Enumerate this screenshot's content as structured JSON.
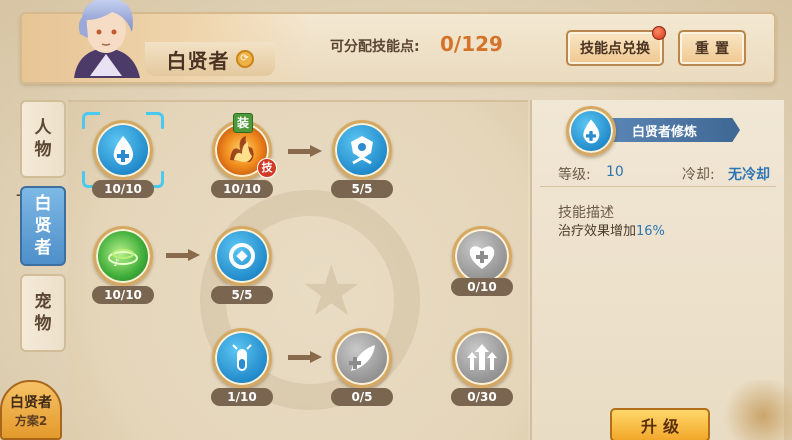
{
  "header": {
    "class_name": "白贤者",
    "points_label": "可分配技能点:",
    "points_value": "0/129",
    "exchange_label": "技能点兑换",
    "reset_label": "重置"
  },
  "tabs": [
    {
      "label_1": "人",
      "label_2": "物"
    },
    {
      "label_1": "白",
      "label_2": "贤",
      "label_3": "者"
    },
    {
      "label_1": "宠",
      "label_2": "物"
    }
  ],
  "plan": {
    "name": "白贤者",
    "sub": "方案2"
  },
  "tree": {
    "nodes": [
      {
        "count": "10/10",
        "icon": "water-drop-plus-icon"
      },
      {
        "count": "10/10",
        "icon": "fire-skill-icon",
        "equip_badge": "装",
        "skill_badge": "技"
      },
      {
        "count": "5/5",
        "icon": "guardian-shield-icon"
      },
      {
        "count": "10/10",
        "icon": "green-vortex-icon"
      },
      {
        "count": "5/5",
        "icon": "cycle-arrows-icon"
      },
      {
        "count": "0/10",
        "icon": "heart-plus-icon"
      },
      {
        "count": "1/10",
        "icon": "potion-vial-icon"
      },
      {
        "count": "0/5",
        "icon": "heal-feather-icon"
      },
      {
        "count": "0/30",
        "icon": "triple-up-arrows-icon"
      }
    ]
  },
  "detail": {
    "skill_name": "白贤者修炼",
    "level_label": "等级:",
    "level_value": "10",
    "cooldown_label": "冷却:",
    "cooldown_value": "无冷却",
    "desc_title": "技能描述",
    "desc_text": "治疗效果增加",
    "desc_value": "16%",
    "upgrade_label": "升级"
  },
  "colors": {
    "accent_blue": "#2e75b4",
    "points_orange": "#d3742a",
    "active_tab": "#4f8fc9"
  }
}
